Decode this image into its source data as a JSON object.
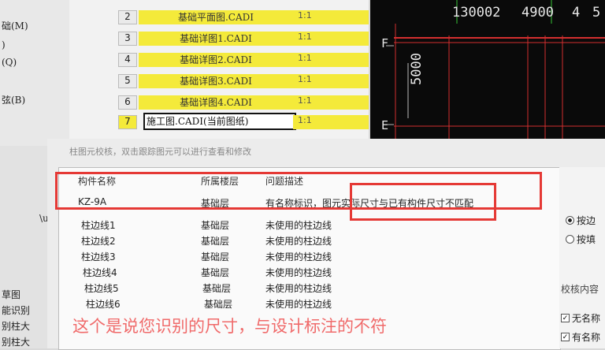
{
  "left_menu": {
    "items": [
      "础(M)",
      ")",
      "(Q)",
      "弦(B)"
    ],
    "lower_items": [
      "草图",
      "能识别",
      "别柱大",
      "别柱大"
    ]
  },
  "drawing_list": {
    "rows": [
      {
        "num": "2",
        "name": "基础平面图.CADI",
        "scale": "1:1"
      },
      {
        "num": "3",
        "name": "基础详图1.CADI",
        "scale": "1:1"
      },
      {
        "num": "4",
        "name": "基础详图2.CADI",
        "scale": "1:1"
      },
      {
        "num": "5",
        "name": "基础详图3.CADI",
        "scale": "1:1"
      },
      {
        "num": "6",
        "name": "基础详图4.CADI",
        "scale": "1:1"
      },
      {
        "num": "7",
        "name": "施工图.CADI(当前图纸)",
        "scale": "1:1"
      }
    ]
  },
  "cad": {
    "top_numbers": [
      "130002",
      "4900",
      "4",
      "5"
    ],
    "side_number": "5000",
    "axis_labels": [
      "F",
      "E"
    ]
  },
  "dialog": {
    "title": "柱图元校核，双击跟踪图元可以进行查看和修改",
    "columns": [
      "构件名称",
      "所属楼层",
      "问题描述"
    ],
    "rows": [
      {
        "name": "KZ-9A",
        "floor": "基础层",
        "desc": "有名称标识，图元实际尺寸与已有构件尺寸不匹配"
      },
      {
        "name": "柱边线1",
        "floor": "基础层",
        "desc": "未使用的柱边线"
      },
      {
        "name": "柱边线2",
        "floor": "基础层",
        "desc": "未使用的柱边线"
      },
      {
        "name": "柱边线3",
        "floor": "基础层",
        "desc": "未使用的柱边线"
      },
      {
        "name": "柱边线4",
        "floor": "基础层",
        "desc": "未使用的柱边线"
      },
      {
        "name": "柱边线5",
        "floor": "基础层",
        "desc": "未使用的柱边线"
      },
      {
        "name": "柱边线6",
        "floor": "基础层",
        "desc": "未使用的柱边线"
      }
    ],
    "right_panel": {
      "radio1": "按边",
      "radio2": "按填",
      "section_label": "校核内容",
      "check1": "无名称",
      "check2": "有名称"
    }
  },
  "annotation": {
    "caption": "这个是说您识别的尺寸，与设计标注的不符",
    "box_color": "#e53935",
    "caption_color": "#f06a6a"
  },
  "colors": {
    "highlight_yellow": "#f4ea3a",
    "cad_background": "#0a0a0a",
    "cad_line_red": "#d32f2f"
  }
}
